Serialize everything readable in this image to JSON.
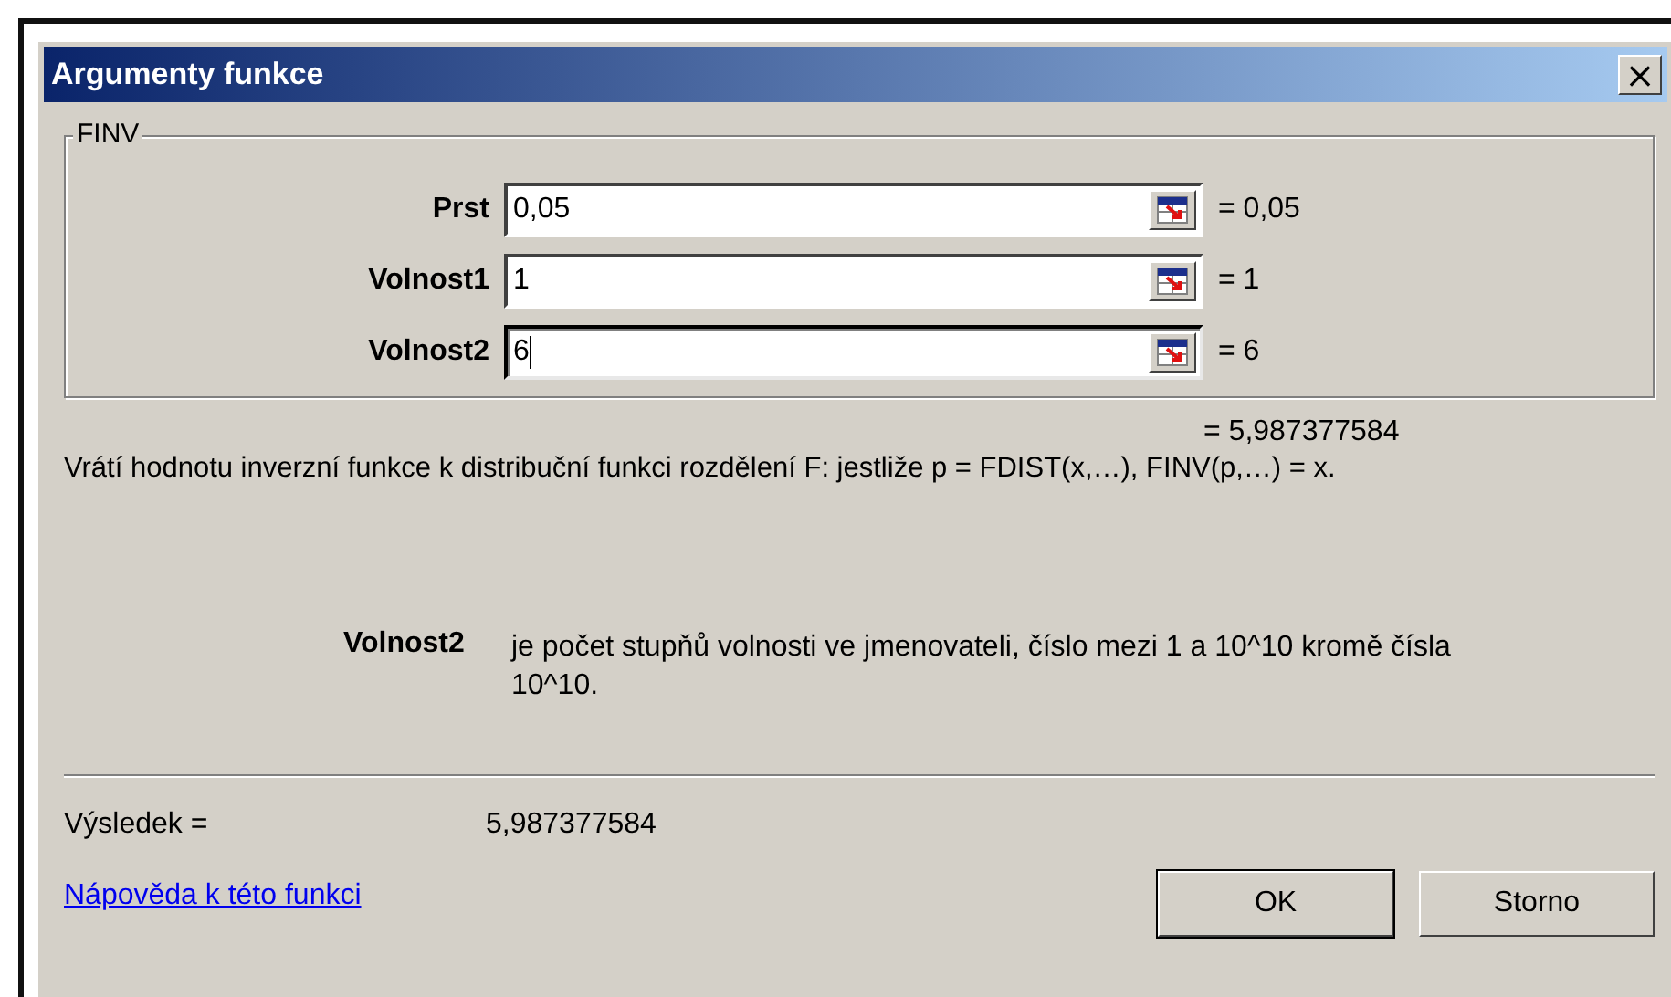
{
  "window": {
    "title": "Argumenty funkce",
    "close": "×"
  },
  "group": {
    "title": "FINV",
    "arguments": [
      {
        "label": "Prst",
        "value": "0,05",
        "result": "= 0,05",
        "focused": false
      },
      {
        "label": "Volnost1",
        "value": "1",
        "result": "= 1",
        "focused": false
      },
      {
        "label": "Volnost2",
        "value": "6",
        "result": "= 6",
        "focused": true
      }
    ]
  },
  "formula_result": "= 5,987377584",
  "description": "Vrátí hodnotu inverzní funkce k distribuční funkci rozdělení F: jestliže p = FDIST(x,…), FINV(p,…) = x.",
  "argument_help": {
    "name": "Volnost2",
    "text": "je počet stupňů volnosti ve jmenovateli, číslo mezi 1 a 10^10 kromě čísla 10^10."
  },
  "result": {
    "label": "Výsledek =",
    "value": "5,987377584"
  },
  "help_link": "Nápověda k této funkci",
  "buttons": [
    {
      "label": "OK",
      "default": true
    },
    {
      "label": "Storno",
      "default": false
    }
  ]
}
